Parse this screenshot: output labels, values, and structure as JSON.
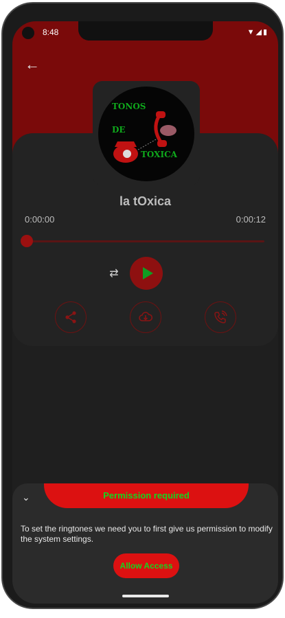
{
  "status_bar": {
    "time": "8:48",
    "icons": "▼◢▮"
  },
  "ringtone": {
    "cover": {
      "line1": "TONOS",
      "line2": "DE",
      "line3": "TOXICA"
    },
    "title": "la tOxica",
    "elapsed": "0:00:00",
    "duration": "0:00:12",
    "progress": 0
  },
  "controls": {
    "repeat_glyph": "⇄",
    "actions": [
      {
        "name": "share",
        "icon": "share-icon"
      },
      {
        "name": "download",
        "icon": "cloud-download-icon"
      },
      {
        "name": "set-ringtone",
        "icon": "phone-ring-icon"
      }
    ]
  },
  "permission_sheet": {
    "title": "Permission required",
    "message": "To set the ringtones we need you to first give us permission to modify the system settings.",
    "button": "Allow Access"
  },
  "colors": {
    "accent": "#dc1111",
    "accent_text": "#14d61e",
    "header": "#7a0a0a"
  }
}
